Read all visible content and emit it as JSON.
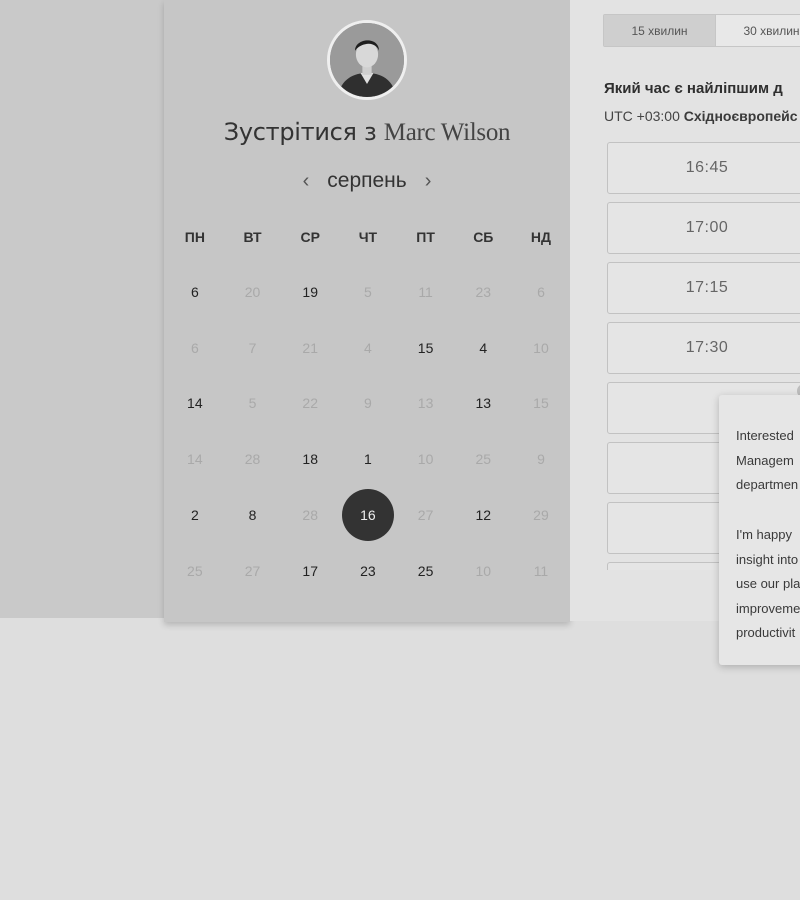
{
  "host": {
    "avatar_icon": "person-photo-avatar",
    "meet_prefix": "Зустрітися з ",
    "name": "Marc Wilson"
  },
  "calendar": {
    "month": "серпень",
    "prev_icon": "chevron-left-icon",
    "next_icon": "chevron-right-icon",
    "prev_glyph": "‹",
    "next_glyph": "›",
    "weekdays": [
      "ПН",
      "ВТ",
      "СР",
      "ЧТ",
      "ПТ",
      "СБ",
      "НД"
    ],
    "weeks": [
      [
        {
          "d": "6",
          "s": "active"
        },
        {
          "d": "20",
          "s": "muted"
        },
        {
          "d": "19",
          "s": "active"
        },
        {
          "d": "5",
          "s": "muted"
        },
        {
          "d": "11",
          "s": "muted"
        },
        {
          "d": "23",
          "s": "muted"
        },
        {
          "d": "6",
          "s": "muted"
        }
      ],
      [
        {
          "d": "6",
          "s": "muted"
        },
        {
          "d": "7",
          "s": "muted"
        },
        {
          "d": "21",
          "s": "muted"
        },
        {
          "d": "4",
          "s": "muted"
        },
        {
          "d": "15",
          "s": "active"
        },
        {
          "d": "4",
          "s": "active"
        },
        {
          "d": "10",
          "s": "muted"
        }
      ],
      [
        {
          "d": "14",
          "s": "active"
        },
        {
          "d": "5",
          "s": "muted"
        },
        {
          "d": "22",
          "s": "muted"
        },
        {
          "d": "9",
          "s": "muted"
        },
        {
          "d": "13",
          "s": "muted"
        },
        {
          "d": "13",
          "s": "active"
        },
        {
          "d": "15",
          "s": "muted"
        }
      ],
      [
        {
          "d": "14",
          "s": "muted"
        },
        {
          "d": "28",
          "s": "muted"
        },
        {
          "d": "18",
          "s": "active"
        },
        {
          "d": "1",
          "s": "active"
        },
        {
          "d": "10",
          "s": "muted"
        },
        {
          "d": "25",
          "s": "muted"
        },
        {
          "d": "9",
          "s": "muted"
        }
      ],
      [
        {
          "d": "2",
          "s": "active"
        },
        {
          "d": "8",
          "s": "active"
        },
        {
          "d": "28",
          "s": "muted"
        },
        {
          "d": "16",
          "s": "selected"
        },
        {
          "d": "27",
          "s": "muted"
        },
        {
          "d": "12",
          "s": "active"
        },
        {
          "d": "29",
          "s": "muted"
        }
      ],
      [
        {
          "d": "25",
          "s": "muted"
        },
        {
          "d": "27",
          "s": "muted"
        },
        {
          "d": "17",
          "s": "active"
        },
        {
          "d": "23",
          "s": "active"
        },
        {
          "d": "25",
          "s": "active"
        },
        {
          "d": "10",
          "s": "muted"
        },
        {
          "d": "11",
          "s": "muted"
        }
      ]
    ]
  },
  "durations": {
    "tabs": [
      "15 хвилин",
      "30 хвилин"
    ],
    "active_index": 0
  },
  "time_picker": {
    "heading": "Який час є найліпшим д",
    "tz_prefix": "UTC +03:00 ",
    "tz_name": "Східноєвропейс",
    "slots": [
      "16:45",
      "17:00",
      "17:15",
      "17:30",
      "",
      "",
      "",
      ""
    ]
  },
  "popup": {
    "paragraph1": "Interested\nManagem\ndepartmen",
    "paragraph2": "I'm happy\ninsight into\nuse our pla\nimproveme\nproductivit"
  },
  "colors": {
    "selected_day": "#333333",
    "page_bg": "#dedede",
    "panel_bg": "#c6c6c6"
  }
}
